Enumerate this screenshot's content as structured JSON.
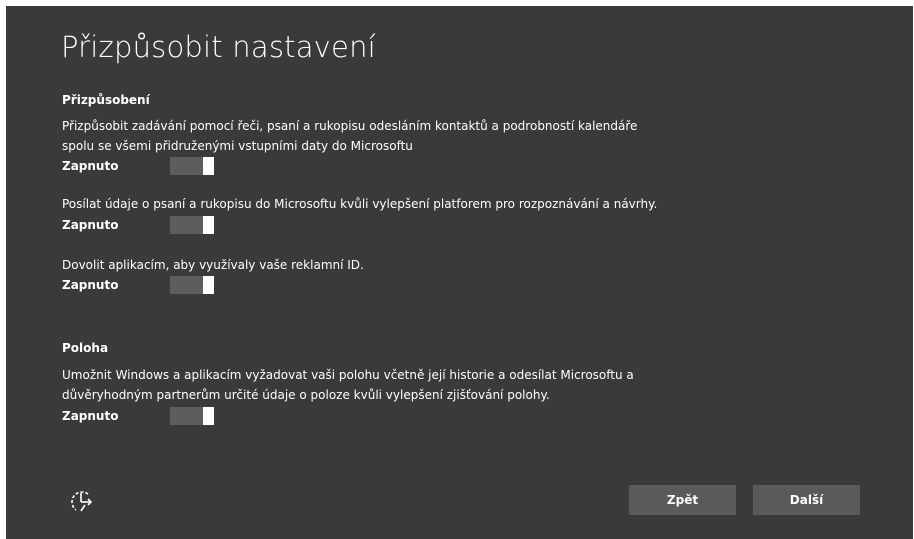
{
  "page": {
    "title": "Přizpůsobit nastavení"
  },
  "sections": {
    "personalization": {
      "heading": "Přizpůsobení",
      "items": [
        {
          "text": "Přizpůsobit zadávání pomocí řeči, psaní a rukopisu odesláním kontaktů a podrobností kalendáře\nspolu se všemi přidruženými vstupními daty do Microsoftu",
          "state_label": "Zapnuto",
          "on": true
        },
        {
          "text": "Posílat údaje o psaní a rukopisu do Microsoftu kvůli vylepšení platforem pro rozpoznávání a návrhy.",
          "state_label": "Zapnuto",
          "on": true
        },
        {
          "text": "Dovolit aplikacím, aby využívaly vaše reklamní ID.",
          "state_label": "Zapnuto",
          "on": true
        }
      ]
    },
    "location": {
      "heading": "Poloha",
      "items": [
        {
          "text": "Umožnit Windows a aplikacím vyžadovat vaši polohu včetně její historie a odesílat Microsoftu a\ndůvěryhodným partnerům určité údaje o poloze kvůli vylepšení zjišťování polohy.",
          "state_label": "Zapnuto",
          "on": true
        }
      ]
    }
  },
  "footer": {
    "ease_of_access_icon": "ease-of-access-icon",
    "back_label": "Zpět",
    "next_label": "Další"
  },
  "colors": {
    "background": "#3a3a3a",
    "button": "#5a5a5a",
    "toggle_track": "#5d5d5d",
    "toggle_knob": "#ffffff"
  }
}
